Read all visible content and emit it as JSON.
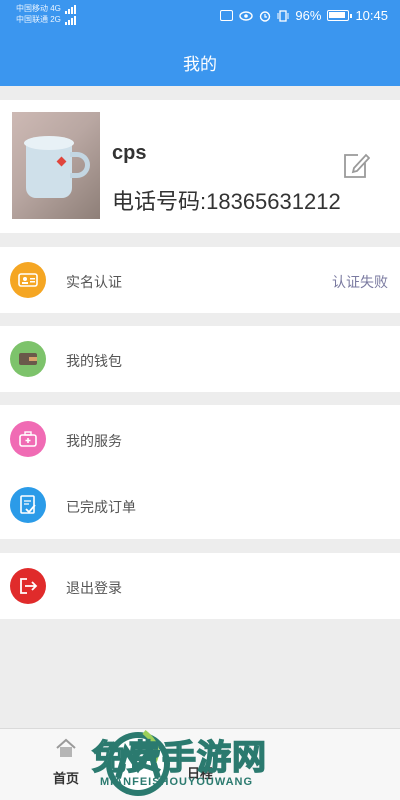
{
  "status_bar": {
    "carrier1": "中国移动",
    "carrier1_net": "4G",
    "carrier2": "中国联通",
    "carrier2_net": "2G",
    "battery": "96%",
    "time": "10:45"
  },
  "header": {
    "title": "我的"
  },
  "profile": {
    "username": "cps",
    "phone": "电话号码:18365631212"
  },
  "menu": {
    "verify": {
      "label": "实名认证",
      "value": "认证失败",
      "icon": "id-card-icon",
      "color": "#f5a623"
    },
    "wallet": {
      "label": "我的钱包",
      "icon": "wallet-icon",
      "color": "#7dc36b"
    },
    "services": {
      "label": "我的服务",
      "icon": "briefcase-icon",
      "color": "#f06bb4"
    },
    "orders": {
      "label": "已完成订单",
      "icon": "checklist-icon",
      "color": "#2b9be8"
    },
    "logout": {
      "label": "退出登录",
      "icon": "exit-icon",
      "color": "#e02b2b"
    }
  },
  "nav": {
    "home": "首页",
    "schedule": "日程"
  },
  "watermark": {
    "title": "免费手游网",
    "subtitle": "MIANFEISHOUYOUWANG"
  }
}
